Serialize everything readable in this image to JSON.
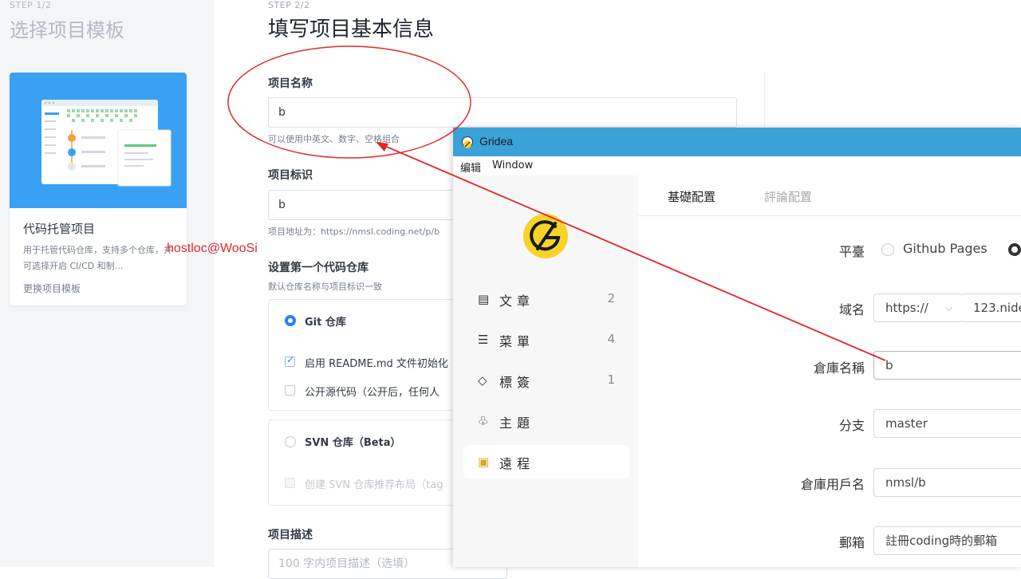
{
  "coding": {
    "step1": {
      "label": "STEP 1/2",
      "title": "选择项目模板"
    },
    "template_card": {
      "title": "代码托管项目",
      "desc": "用于托管代码仓库，支持多个仓库，并可选择开启 CI/CD 和制...",
      "link": "更换项目模板"
    },
    "step2": {
      "label": "STEP 2/2",
      "title": "填写项目基本信息"
    },
    "project_name": {
      "label": "项目名称",
      "value": "b",
      "hint": "可以使用中英文、数字、空格组合"
    },
    "project_id": {
      "label": "项目标识",
      "value": "b",
      "hint": "项目地址为：https://nmsl.coding.net/p/b"
    },
    "repo_section": {
      "title": "设置第一个代码仓库",
      "hint": "默认仓库名称与项目标识一致"
    },
    "git_option": {
      "label": "Git 仓库",
      "readme": "启用 README.md 文件初始化",
      "public": "公开源代码（公开后，任何人"
    },
    "svn_option": {
      "label": "SVN 仓库（Beta）",
      "layout": "创建 SVN 仓库推荐布局（tag"
    },
    "description": {
      "label": "项目描述",
      "placeholder": "100 字内项目描述（选填）"
    }
  },
  "watermark": "hostloc@WooSi",
  "gridea": {
    "window_title": "Gridea",
    "menu": [
      "编辑",
      "Window"
    ],
    "nav": [
      {
        "icon": "▤",
        "label": "文章",
        "count": "2"
      },
      {
        "icon": "☰",
        "label": "菜單",
        "count": "4"
      },
      {
        "icon": "◇",
        "label": "標簽",
        "count": "1"
      },
      {
        "icon": "♧",
        "label": "主題",
        "count": ""
      },
      {
        "icon": "▣",
        "label": "遠程",
        "count": ""
      }
    ],
    "tabs": {
      "basic": "基礎配置",
      "comment": "評論配置"
    },
    "platform": {
      "label": "平臺",
      "option_github": "Github Pages"
    },
    "domain": {
      "label": "域名",
      "protocol": "https://",
      "value": "123.nide"
    },
    "repo_name": {
      "label": "倉庫名稱",
      "value": "b"
    },
    "branch": {
      "label": "分支",
      "value": "master"
    },
    "username": {
      "label": "倉庫用戶名",
      "value": "nmsl/b"
    },
    "email": {
      "label": "郵箱",
      "value": "註冊coding時的郵箱"
    }
  },
  "colors": {
    "accent_blue": "#3aa0f3",
    "gridea_titlebar": "#3ba2d9",
    "annotation_red": "#e0292b",
    "gridea_logo_yellow": "#f7d32a"
  }
}
